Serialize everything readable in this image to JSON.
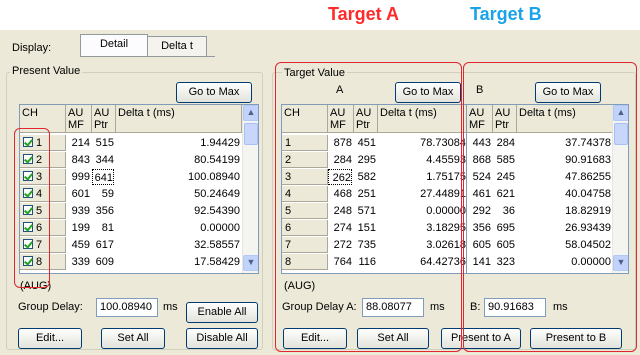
{
  "targets": {
    "a_title": "Target A",
    "b_title": "Target B"
  },
  "display": {
    "label": "Display:",
    "tabs": [
      "Detail",
      "Delta t"
    ]
  },
  "present": {
    "legend": "Present Value",
    "go_to_max": "Go to Max",
    "headers": {
      "ch": "CH",
      "au_mf": "AU\nMF",
      "au_ptr": "AU\nPtr",
      "delta": "Delta t (ms)"
    },
    "rows": [
      {
        "ch": "1",
        "mf": "214",
        "ptr": "515",
        "delta": "1.94429"
      },
      {
        "ch": "2",
        "mf": "843",
        "ptr": "344",
        "delta": "80.54199"
      },
      {
        "ch": "3",
        "mf": "999",
        "ptr": "641",
        "delta": "100.08940"
      },
      {
        "ch": "4",
        "mf": "601",
        "ptr": "59",
        "delta": "50.24649"
      },
      {
        "ch": "5",
        "mf": "939",
        "ptr": "356",
        "delta": "92.54390"
      },
      {
        "ch": "6",
        "mf": "199",
        "ptr": "81",
        "delta": "0.00000"
      },
      {
        "ch": "7",
        "mf": "459",
        "ptr": "617",
        "delta": "32.58557"
      },
      {
        "ch": "8",
        "mf": "339",
        "ptr": "609",
        "delta": "17.58429"
      }
    ],
    "aug": "(AUG)",
    "group_delay_label": "Group Delay:",
    "group_delay_value": "100.08940",
    "ms": "ms",
    "enable_all": "Enable All",
    "edit": "Edit...",
    "set_all": "Set All",
    "disable_all": "Disable All"
  },
  "target": {
    "legend": "Target Value",
    "a_label": "A",
    "b_label": "B",
    "go_to_max": "Go to Max",
    "headers": {
      "ch": "CH",
      "au_mf": "AU\nMF",
      "au_ptr": "AU\nPtr",
      "delta": "Delta t (ms)"
    },
    "rows_a": [
      {
        "ch": "1",
        "mf": "878",
        "ptr": "451",
        "delta": "78.73084"
      },
      {
        "ch": "2",
        "mf": "284",
        "ptr": "295",
        "delta": "4.45593"
      },
      {
        "ch": "3",
        "mf": "262",
        "ptr": "582",
        "delta": "1.75175"
      },
      {
        "ch": "4",
        "mf": "468",
        "ptr": "251",
        "delta": "27.44891"
      },
      {
        "ch": "5",
        "mf": "248",
        "ptr": "571",
        "delta": "0.00000"
      },
      {
        "ch": "6",
        "mf": "274",
        "ptr": "151",
        "delta": "3.18295"
      },
      {
        "ch": "7",
        "mf": "272",
        "ptr": "735",
        "delta": "3.02618"
      },
      {
        "ch": "8",
        "mf": "764",
        "ptr": "116",
        "delta": "64.42736"
      }
    ],
    "rows_b": [
      {
        "mf": "443",
        "ptr": "284",
        "delta": "37.74378"
      },
      {
        "mf": "868",
        "ptr": "585",
        "delta": "90.91683"
      },
      {
        "mf": "524",
        "ptr": "245",
        "delta": "47.86255"
      },
      {
        "mf": "461",
        "ptr": "621",
        "delta": "40.04758"
      },
      {
        "mf": "292",
        "ptr": "36",
        "delta": "18.82919"
      },
      {
        "mf": "356",
        "ptr": "695",
        "delta": "26.93439"
      },
      {
        "mf": "605",
        "ptr": "605",
        "delta": "58.04502"
      },
      {
        "mf": "141",
        "ptr": "323",
        "delta": "0.00000"
      }
    ],
    "aug": "(AUG)",
    "group_delay_a_label": "Group Delay A:",
    "group_delay_a_value": "88.08077",
    "b_delay_label": "B:",
    "b_delay_value": "90.91683",
    "ms": "ms",
    "edit": "Edit...",
    "set_all": "Set All",
    "present_to_a": "Present to A",
    "present_to_b": "Present to B"
  },
  "colors": {
    "target_a": "#ff2a2a",
    "target_b": "#1aa3e8",
    "highlight_box": "#e0262f"
  }
}
